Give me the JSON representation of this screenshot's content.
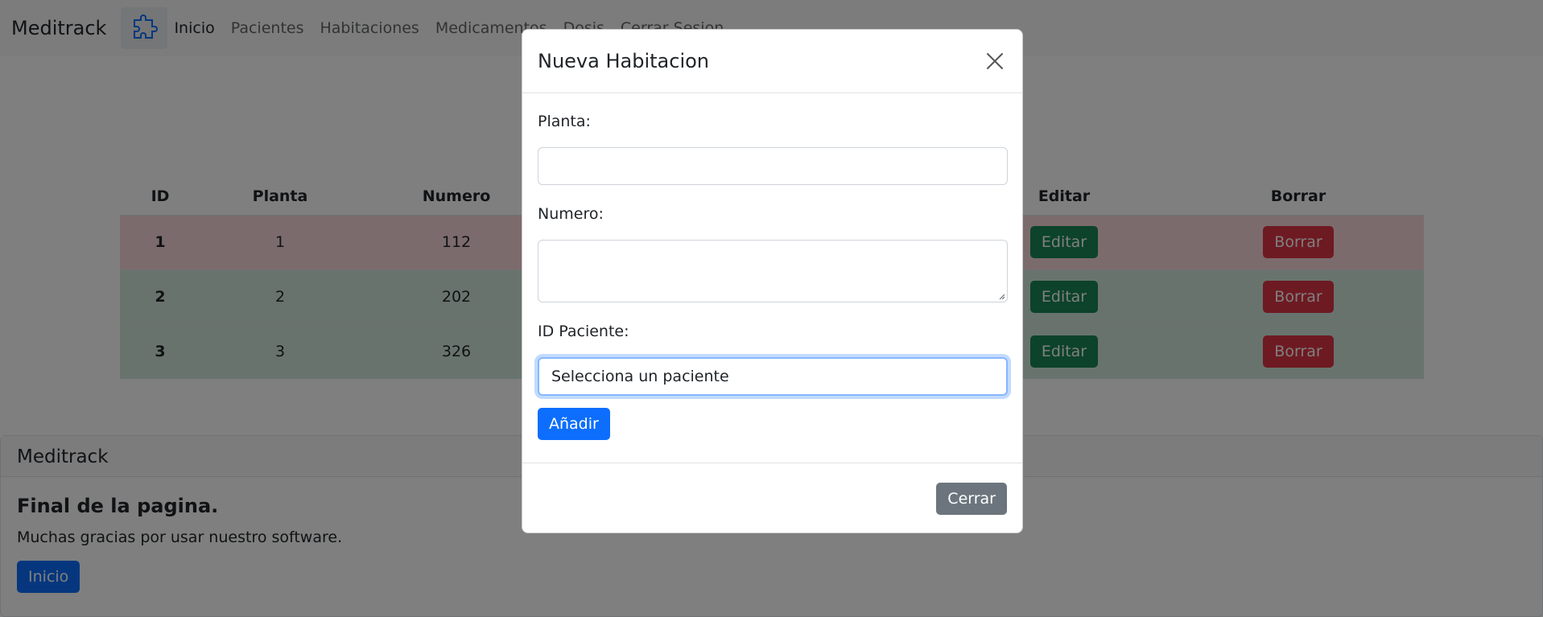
{
  "navbar": {
    "brand": "Meditrack",
    "logo_icon": "puzzle-icon",
    "links": [
      "Inicio",
      "Pacientes",
      "Habitaciones",
      "Medicamentos",
      "Dosis",
      "Cerrar Sesion"
    ]
  },
  "table": {
    "headers": [
      "ID",
      "Planta",
      "Numero",
      "Editar",
      "Borrar"
    ],
    "rows": [
      {
        "id": "1",
        "planta": "1",
        "numero": "112",
        "edit": "Editar",
        "delete": "Borrar",
        "status": "red"
      },
      {
        "id": "2",
        "planta": "2",
        "numero": "202",
        "edit": "Editar",
        "delete": "Borrar",
        "status": "green"
      },
      {
        "id": "3",
        "planta": "3",
        "numero": "326",
        "edit": "Editar",
        "delete": "Borrar",
        "status": "green"
      }
    ]
  },
  "footer": {
    "header": "Meditrack",
    "title": "Final de la pagina.",
    "text": "Muchas gracias por usar nuestro software.",
    "button": "Inicio"
  },
  "modal": {
    "title": "Nueva Habitacion",
    "close_icon": "close-icon",
    "planta_label": "Planta:",
    "planta_value": "",
    "numero_label": "Numero:",
    "numero_value": "",
    "paciente_label": "ID Paciente:",
    "paciente_value": "Selecciona un paciente",
    "add_button": "Añadir",
    "close_button": "Cerrar"
  },
  "colors": {
    "primary": "#0d6efd",
    "success": "#198754",
    "danger": "#dc3545",
    "secondary": "#6c757d",
    "row_red": "#f8d7da",
    "row_green": "#d1e7dd"
  }
}
